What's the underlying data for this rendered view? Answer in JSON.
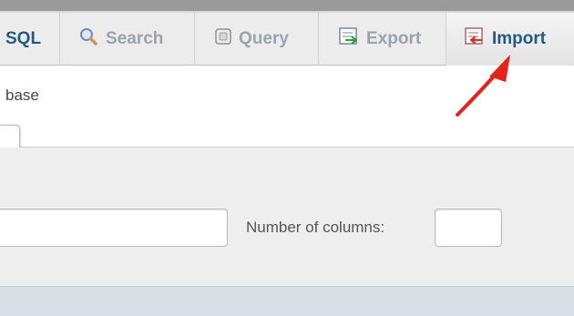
{
  "tabs": [
    {
      "label": "SQL",
      "icon": "sql-icon",
      "active": false
    },
    {
      "label": "Search",
      "icon": "magnifier-icon",
      "active": false
    },
    {
      "label": "Query",
      "icon": "query-icon",
      "active": false
    },
    {
      "label": "Export",
      "icon": "export-icon",
      "active": false
    },
    {
      "label": "Import",
      "icon": "import-icon",
      "active": true
    }
  ],
  "form": {
    "database_label": "base",
    "columns_label": "Number of columns:",
    "table_name_value": "",
    "columns_value": ""
  },
  "colors": {
    "active_tab_text": "#235a81",
    "inactive_tab_text": "#9aa3ad",
    "annotation_arrow": "#e3241b"
  }
}
